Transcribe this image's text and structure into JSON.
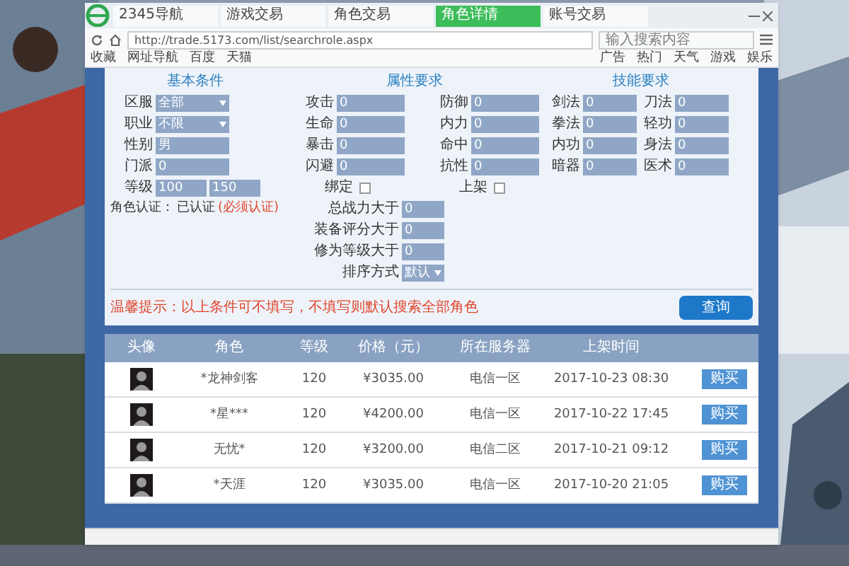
{
  "browser": {
    "tabs": [
      {
        "label": "2345导航",
        "selected": false
      },
      {
        "label": "游戏交易",
        "selected": false
      },
      {
        "label": "角色交易",
        "selected": false
      },
      {
        "label": "角色详情",
        "selected": true
      },
      {
        "label": "账号交易",
        "selected": false
      }
    ],
    "address": "http://trade.5173.com/list/searchrole.aspx",
    "search_placeholder": "输入搜索内容",
    "bookmarks_left": [
      "收藏",
      "网址导航",
      "百度",
      "天猫"
    ],
    "bookmarks_right": [
      "广告",
      "热门",
      "天气",
      "游戏",
      "娱乐"
    ]
  },
  "basic": {
    "title": "基本条件",
    "fields": [
      {
        "label": "区服",
        "kind": "select",
        "value": "全部"
      },
      {
        "label": "职业",
        "kind": "select",
        "value": "不限"
      },
      {
        "label": "性别",
        "kind": "input",
        "value": "男"
      },
      {
        "label": "门派",
        "kind": "input",
        "value": "0"
      }
    ]
  },
  "attributes": {
    "title": "属性要求",
    "fields": [
      {
        "label": "攻击",
        "value": "0"
      },
      {
        "label": "防御",
        "value": "0"
      },
      {
        "label": "生命",
        "value": "0"
      },
      {
        "label": "内力",
        "value": "0"
      },
      {
        "label": "暴击",
        "value": "0"
      },
      {
        "label": "命中",
        "value": "0"
      },
      {
        "label": "闪避",
        "value": "0"
      },
      {
        "label": "抗性",
        "value": "0"
      }
    ]
  },
  "skills": {
    "title": "技能要求",
    "fields": [
      {
        "label": "剑法",
        "value": "0"
      },
      {
        "label": "刀法",
        "value": "0"
      },
      {
        "label": "拳法",
        "value": "0"
      },
      {
        "label": "轻功",
        "value": "0"
      },
      {
        "label": "内功",
        "value": "0"
      },
      {
        "label": "身法",
        "value": "0"
      },
      {
        "label": "暗器",
        "value": "0"
      },
      {
        "label": "医术",
        "value": "0"
      }
    ]
  },
  "level": {
    "label": "等级",
    "from": "100",
    "to": "150"
  },
  "checks": [
    {
      "label": "绑定",
      "checked": false
    },
    {
      "label": "上架",
      "checked": false
    }
  ],
  "note": {
    "label": "角色认证：",
    "value": "已认证",
    "highlight": "(必须认证)"
  },
  "extra_fields": [
    {
      "label": "总战力大于",
      "kind": "input",
      "value": "0"
    },
    {
      "label": "装备评分大于",
      "kind": "input",
      "value": "0"
    },
    {
      "label": "修为等级大于",
      "kind": "input",
      "value": "0"
    },
    {
      "label": "排序方式",
      "kind": "select",
      "value": "默认"
    }
  ],
  "hint": "温馨提示：以上条件可不填写，不填写则默认搜索全部角色",
  "search_button": "查询",
  "table": {
    "columns": [
      "头像",
      "角色",
      "等级",
      "价格（元）",
      "所在服务器",
      "上架时间"
    ],
    "rows": [
      {
        "name": "*龙神剑客",
        "level": "120",
        "price": "¥3035.00",
        "server": "电信一区",
        "time": "2017-10-23 08:30",
        "action": "购买"
      },
      {
        "name": "*星***",
        "level": "120",
        "price": "¥4200.00",
        "server": "电信一区",
        "time": "2017-10-22 17:45",
        "action": "购买"
      },
      {
        "name": "无忧*",
        "level": "120",
        "price": "¥3200.00",
        "server": "电信二区",
        "time": "2017-10-21 09:12",
        "action": "购买"
      },
      {
        "name": "*天涯",
        "level": "120",
        "price": "¥3035.00",
        "server": "电信一区",
        "time": "2017-10-20 21:05",
        "action": "购买"
      }
    ]
  }
}
